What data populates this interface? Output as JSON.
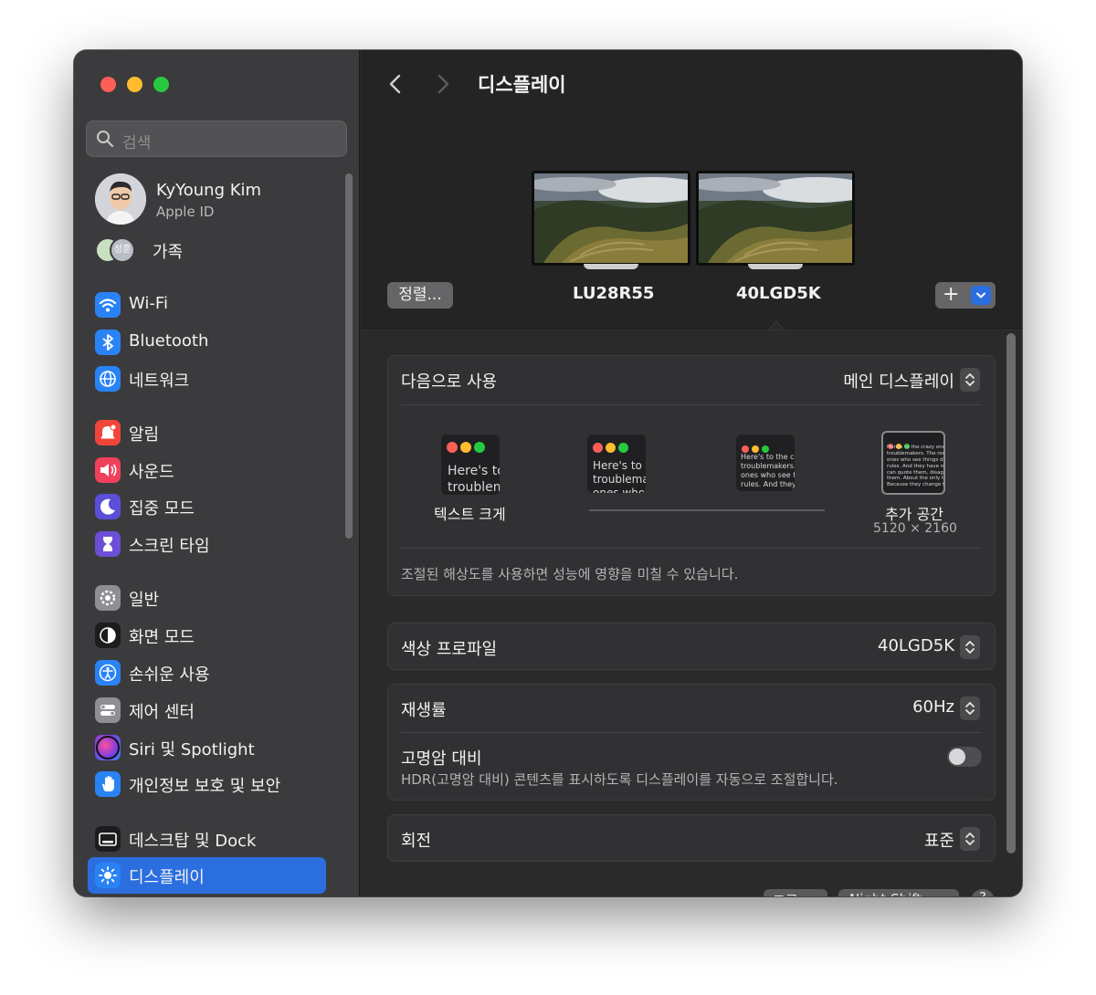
{
  "window": {
    "title": "디스플레이"
  },
  "sidebar": {
    "search": {
      "placeholder": "검색"
    },
    "profile": {
      "name": "KyYoung Kim",
      "subtitle": "Apple ID"
    },
    "family": {
      "label": "가족",
      "member_initials": "성훈"
    },
    "groups": [
      [
        {
          "label": "Wi-Fi",
          "icon": "wifi-icon",
          "color": "#2a83f5"
        },
        {
          "label": "Bluetooth",
          "icon": "bluetooth-icon",
          "color": "#2a83f5"
        },
        {
          "label": "네트워크",
          "icon": "globe-icon",
          "color": "#2a83f5"
        }
      ],
      [
        {
          "label": "알림",
          "icon": "bell-icon",
          "color": "#f0453a"
        },
        {
          "label": "사운드",
          "icon": "speaker-icon",
          "color": "#f0405a"
        },
        {
          "label": "집중 모드",
          "icon": "moon-icon",
          "color": "#5a4fd6"
        },
        {
          "label": "스크린 타임",
          "icon": "hourglass-icon",
          "color": "#6b4fd6"
        }
      ],
      [
        {
          "label": "일반",
          "icon": "gear-icon",
          "color": "#8e8e93"
        },
        {
          "label": "화면 모드",
          "icon": "appearance-icon",
          "color": "#1c1c1e"
        },
        {
          "label": "손쉬운 사용",
          "icon": "accessibility-icon",
          "color": "#2a83f5"
        },
        {
          "label": "제어 센터",
          "icon": "control-center-icon",
          "color": "#8e8e93"
        },
        {
          "label": "Siri 및 Spotlight",
          "icon": "siri-icon",
          "color": "#7b3fe4"
        },
        {
          "label": "개인정보 보호 및 보안",
          "icon": "hand-icon",
          "color": "#2a83f5"
        }
      ],
      [
        {
          "label": "데스크탑 및 Dock",
          "icon": "dock-icon",
          "color": "#1c1c1e"
        },
        {
          "label": "디스플레이",
          "icon": "sun-icon",
          "color": "#2a83f5",
          "selected": true
        }
      ]
    ]
  },
  "toolbar": {
    "title": "디스플레이",
    "arrange_label": "정렬...",
    "add_label": "+",
    "monitors": [
      {
        "name": "LU28R55"
      },
      {
        "name": "40LGD5K",
        "selected": true
      }
    ]
  },
  "use_as": {
    "label": "다음으로 사용",
    "value": "메인 디스플레이",
    "resolution_options": [
      {
        "sample": "Here's to the\ntroublem"
      },
      {
        "sample": "Here's to t\ntroublema\nones who"
      },
      {
        "sample": "Here's to the cr\ntroublemakers.\nones who see t\nrules. And they"
      },
      {
        "sample": "Here's to the crazy one\ntroublemakers. The rou\nones who see things dif\nrules. And they have no\ncan quote them, disagr\nthem. About the only th\nBecause they change t"
      }
    ],
    "larger_text_label": "텍스트 크게",
    "more_space_label": "추가 공간",
    "more_space_resolution": "5120 × 2160",
    "note": "조절된 해상도를 사용하면 성능에 영향을 미칠 수 있습니다."
  },
  "color_profile": {
    "label": "색상 프로파일",
    "value": "40LGD5K"
  },
  "refresh_rate": {
    "label": "재생률",
    "value": "60Hz"
  },
  "hdr": {
    "label": "고명암 대비",
    "description": "HDR(고명암 대비) 콘텐츠를 표시하도록 디스플레이를 자동으로 조절합니다.",
    "enabled": false
  },
  "rotation": {
    "label": "회전",
    "value": "표준"
  },
  "bottom_buttons": {
    "advanced_label": "고급...",
    "night_shift_label": "Night Shift...",
    "help_label": "?"
  },
  "colors": {
    "accent": "#2a6ee0",
    "sidebar_bg": "#3b3b3d",
    "main_bg": "#2a2a2a"
  }
}
